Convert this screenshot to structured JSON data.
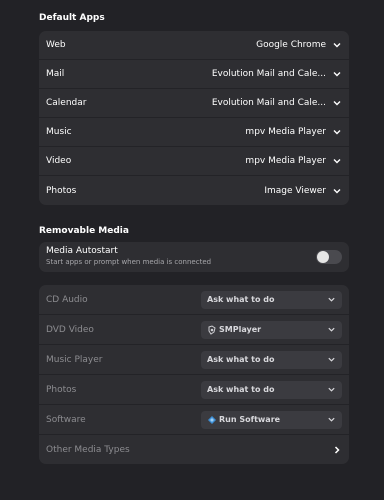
{
  "default_apps": {
    "title": "Default Apps",
    "rows": [
      {
        "label": "Web",
        "value": "Google Chrome"
      },
      {
        "label": "Mail",
        "value": "Evolution Mail and Cale..."
      },
      {
        "label": "Calendar",
        "value": "Evolution Mail and Cale..."
      },
      {
        "label": "Music",
        "value": "mpv Media Player"
      },
      {
        "label": "Video",
        "value": "mpv Media Player"
      },
      {
        "label": "Photos",
        "value": "Image Viewer"
      }
    ]
  },
  "removable_media": {
    "title": "Removable Media",
    "autostart": {
      "label": "Media Autostart",
      "description": "Start apps or prompt when media is connected",
      "enabled": false
    },
    "rows": [
      {
        "label": "CD Audio",
        "value": "Ask what to do"
      },
      {
        "label": "DVD Video",
        "value": "SMPlayer",
        "icon": "smplayer-icon"
      },
      {
        "label": "Music Player",
        "value": "Ask what to do"
      },
      {
        "label": "Photos",
        "value": "Ask what to do"
      },
      {
        "label": "Software",
        "value": "Run Software",
        "icon": "run-software-icon"
      }
    ],
    "other": {
      "label": "Other Media Types"
    }
  },
  "colors": {
    "background": "#222226",
    "card": "#2e2e32",
    "dropdown": "#3b3b40",
    "muted_label": "#8c8c90"
  }
}
